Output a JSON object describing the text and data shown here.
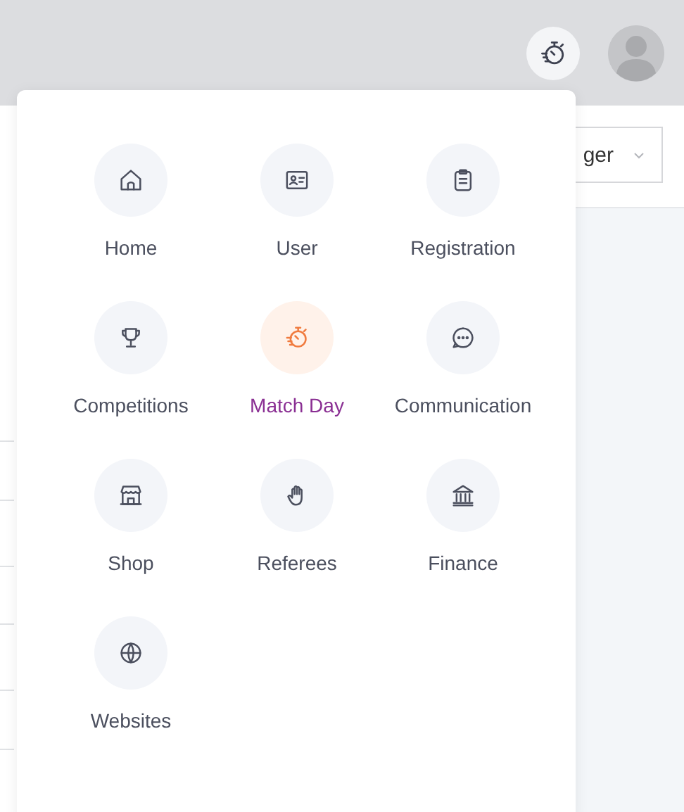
{
  "header": {
    "match_day_button": {
      "selected": true
    }
  },
  "role_select": {
    "value": "ger"
  },
  "app_menu": {
    "items": [
      {
        "label": "Home",
        "selected": false
      },
      {
        "label": "User",
        "selected": false
      },
      {
        "label": "Registration",
        "selected": false
      },
      {
        "label": "Competitions",
        "selected": false
      },
      {
        "label": "Match Day",
        "selected": true
      },
      {
        "label": "Communication",
        "selected": false
      },
      {
        "label": "Shop",
        "selected": false
      },
      {
        "label": "Referees",
        "selected": false
      },
      {
        "label": "Finance",
        "selected": false
      },
      {
        "label": "Websites",
        "selected": false
      }
    ]
  }
}
